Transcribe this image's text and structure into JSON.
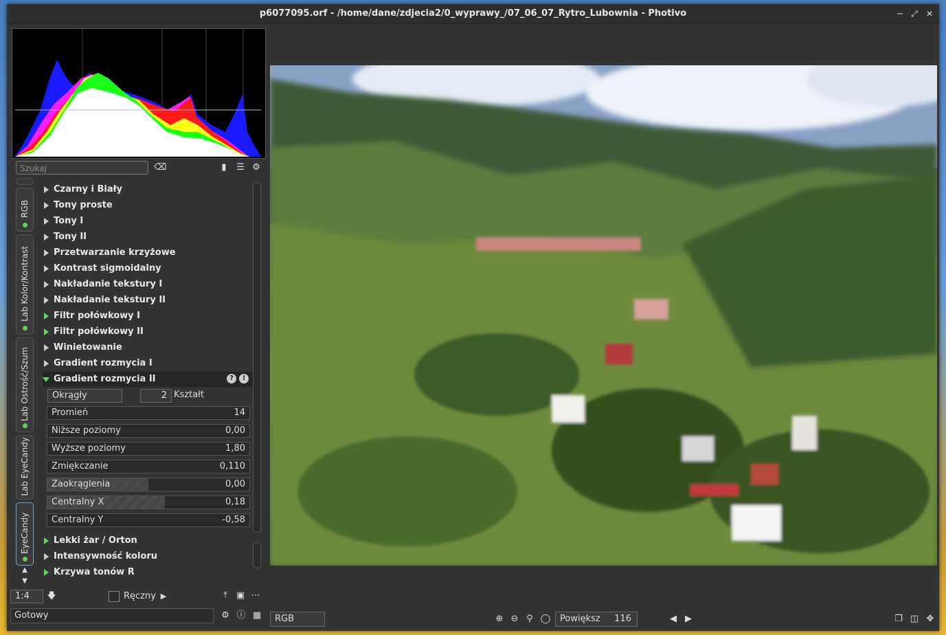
{
  "window": {
    "title": "p6077095.orf - /home/dane/zdjecia2/0_wyprawy_/07_06_07_Rytro_Lubownia - Photivo"
  },
  "search": {
    "placeholder": "Szukaj"
  },
  "tabs": [
    {
      "label": "RGB"
    },
    {
      "label": "Lab Kolor/Kontrast"
    },
    {
      "label": "Lab Ostrość/Szum"
    },
    {
      "label": "Lab EyeCandy"
    },
    {
      "label": "EyeCandy"
    }
  ],
  "filters": [
    {
      "label": "Czarny i Biały",
      "active": false
    },
    {
      "label": "Tony proste",
      "active": false
    },
    {
      "label": "Tony I",
      "active": false
    },
    {
      "label": "Tony II",
      "active": false
    },
    {
      "label": "Przetwarzanie krzyżowe",
      "active": false
    },
    {
      "label": "Kontrast sigmoidalny",
      "active": false
    },
    {
      "label": "Nakładanie tekstury I",
      "active": false
    },
    {
      "label": "Nakładanie tekstury II",
      "active": false
    },
    {
      "label": "Filtr połówkowy I",
      "active": true
    },
    {
      "label": "Filtr połówkowy II",
      "active": true
    },
    {
      "label": "Winietowanie",
      "active": false
    },
    {
      "label": "Gradient rozmycia I",
      "active": false
    },
    {
      "label": "Gradient rozmycia II",
      "active": true,
      "open": true
    }
  ],
  "gradient": {
    "shape_value": "Okrągły",
    "shape_count": "2",
    "shape_label": "Kształt",
    "sliders": [
      {
        "label": "Promień",
        "value": "14",
        "fill": 0.0
      },
      {
        "label": "Niższe poziomy",
        "value": "0,00",
        "fill": 0.0
      },
      {
        "label": "Wyższe poziomy",
        "value": "1,80",
        "fill": 0.0
      },
      {
        "label": "Zmiękczanie",
        "value": "0,110",
        "fill": 0.0
      },
      {
        "label": "Zaokrąglenia",
        "value": "0,00",
        "fill": 0.5
      },
      {
        "label": "Centralny X",
        "value": "0,18",
        "fill": 0.58
      },
      {
        "label": "Centralny Y",
        "value": "-0,58",
        "fill": 0.0
      }
    ]
  },
  "filters_after": [
    {
      "label": "Lekki żar / Orton",
      "active": true
    },
    {
      "label": "Intensywność koloru",
      "active": false
    },
    {
      "label": "Krzywa tonów R",
      "active": true
    }
  ],
  "bottom_left": {
    "zoom_ratio": "1:4",
    "manual_label": "Ręczny"
  },
  "status": {
    "text": "Gotowy"
  },
  "bottom_bar": {
    "color_mode": "RGB",
    "zoom_label": "Powiększ",
    "zoom_value": "116"
  }
}
